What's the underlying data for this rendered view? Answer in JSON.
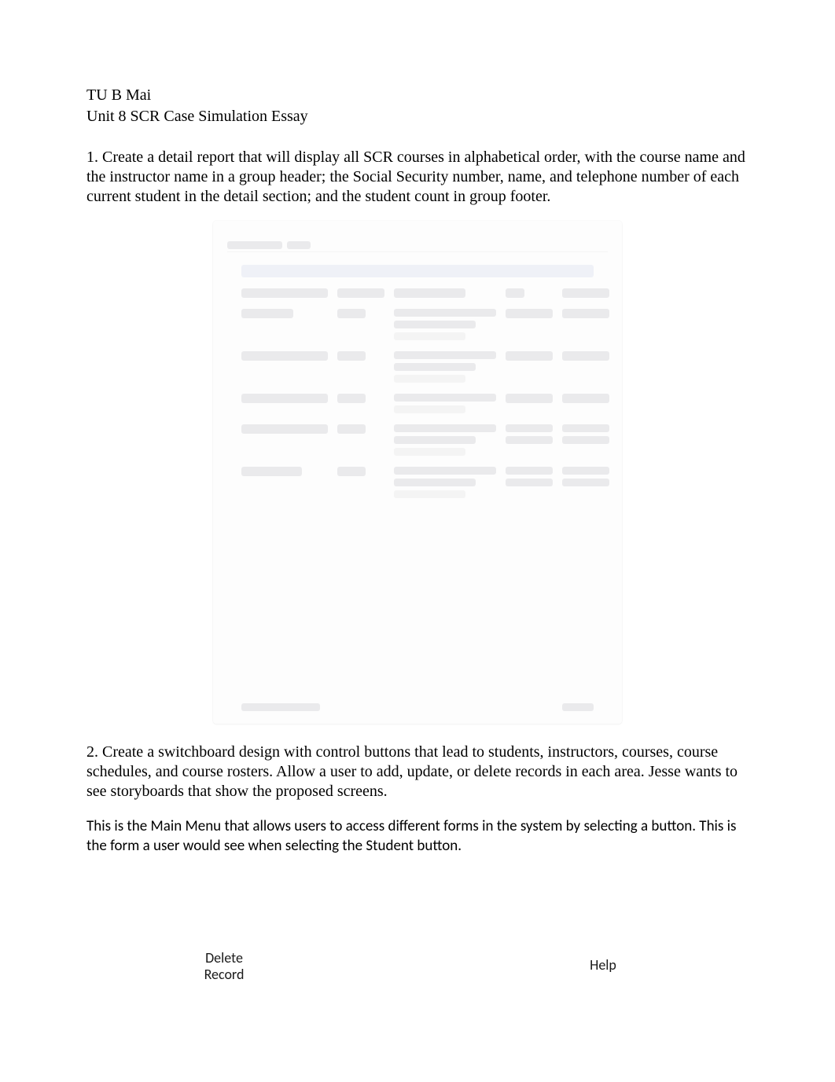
{
  "header": {
    "author": "TU B Mai",
    "title": "Unit 8 SCR Case Simulation Essay"
  },
  "questions": {
    "q1": "1. Create a detail report that will display all SCR courses in alphabetical order, with the course name and the instructor name in a group header; the Social Security number, name, and telephone number of each current student in the detail section; and the student count in group footer.",
    "q2": "2. Create a switchboard design with control buttons that lead to students, instructors, courses, course schedules, and course rosters. Allow a user to add, update, or delete records in each area. Jesse wants to see storyboards that show the proposed screens."
  },
  "description": " This is the Main Menu that allows users to access different forms in the system by selecting a button. This is the form a user would see when selecting the Student button.",
  "buttons": {
    "delete_line1": "Delete",
    "delete_line2": "Record",
    "help": "Help"
  }
}
